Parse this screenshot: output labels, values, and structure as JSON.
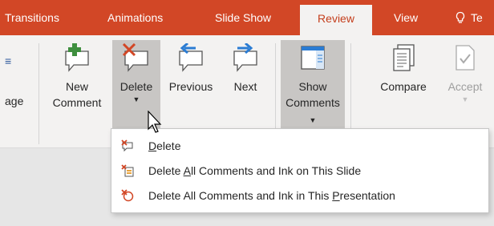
{
  "tabs": {
    "transitions": "Transitions",
    "animations": "Animations",
    "slideshow": "Slide Show",
    "review": "Review",
    "view": "View",
    "tell": "Te"
  },
  "ribbon": {
    "peek_label": "age",
    "new_comment": [
      "New",
      "Comment"
    ],
    "delete": "Delete",
    "previous": "Previous",
    "next": "Next",
    "show_comments": [
      "Show",
      "Comments"
    ],
    "compare": "Compare",
    "accept": "Accept"
  },
  "menu": {
    "item1": {
      "pre": "",
      "key": "D",
      "post": "elete"
    },
    "item2": {
      "pre": "Delete ",
      "key": "A",
      "post": "ll Comments and Ink on This Slide"
    },
    "item3": {
      "pre": "Delete All Comments and Ink in This ",
      "key": "P",
      "post": "resentation"
    }
  },
  "colors": {
    "tab_bar": "#d24726",
    "ribbon_bg": "#f3f2f1",
    "active_tab_text": "#c43e1c",
    "pressed_button": "#c8c6c4"
  },
  "icons": {
    "new_comment": "comment-plus-icon",
    "delete": "comment-delete-icon",
    "previous": "comment-previous-icon",
    "next": "comment-next-icon",
    "show_comments": "show-comments-pane-icon",
    "compare": "compare-icon",
    "accept": "accept-icon",
    "tell_me": "lightbulb-icon"
  }
}
